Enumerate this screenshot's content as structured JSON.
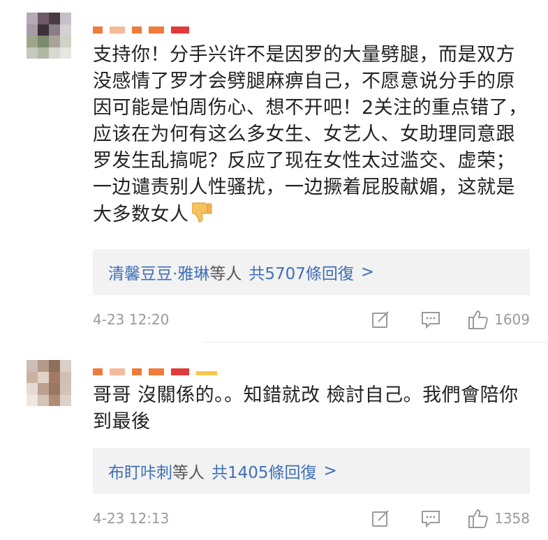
{
  "comments": [
    {
      "text": "支持你！分手兴许不是因罗的大量劈腿，而是双方没感情了罗才会劈腿麻痹自己，不愿意说分手的原因可能是怕周伤心、想不开吧！2关注的重点错了，应该在为何有这么多女生、女艺人、女助理同意跟罗发生乱搞呢？反应了现在女性太过滥交、虚荣；一边谴责别人性骚扰，一边撅着屁股献媚，这就是大多数女人",
      "emoji": "thumbs-down-emoji",
      "reply_names": "清馨豆豆·雅琳",
      "reply_mid": "等人",
      "reply_count": "共5707條回復",
      "reply_chevron": ">",
      "date": "4-23 12:20",
      "likes": "1609"
    },
    {
      "text": "哥哥 沒關係的。。知錯就改 檢討自己。我們會陪你到最後",
      "reply_names": "布盯咔刺",
      "reply_mid": "等人",
      "reply_count": "共1405條回復",
      "reply_chevron": ">",
      "date": "4-23 12:13",
      "likes": "1358"
    }
  ],
  "icons": {
    "share": "edit-share-icon",
    "comment": "comment-bubble-icon",
    "like": "thumbs-up-icon"
  },
  "colors": {
    "link": "#3f6fb8",
    "meta": "#9a9a9a",
    "reply_bg": "#f2f2f2"
  }
}
